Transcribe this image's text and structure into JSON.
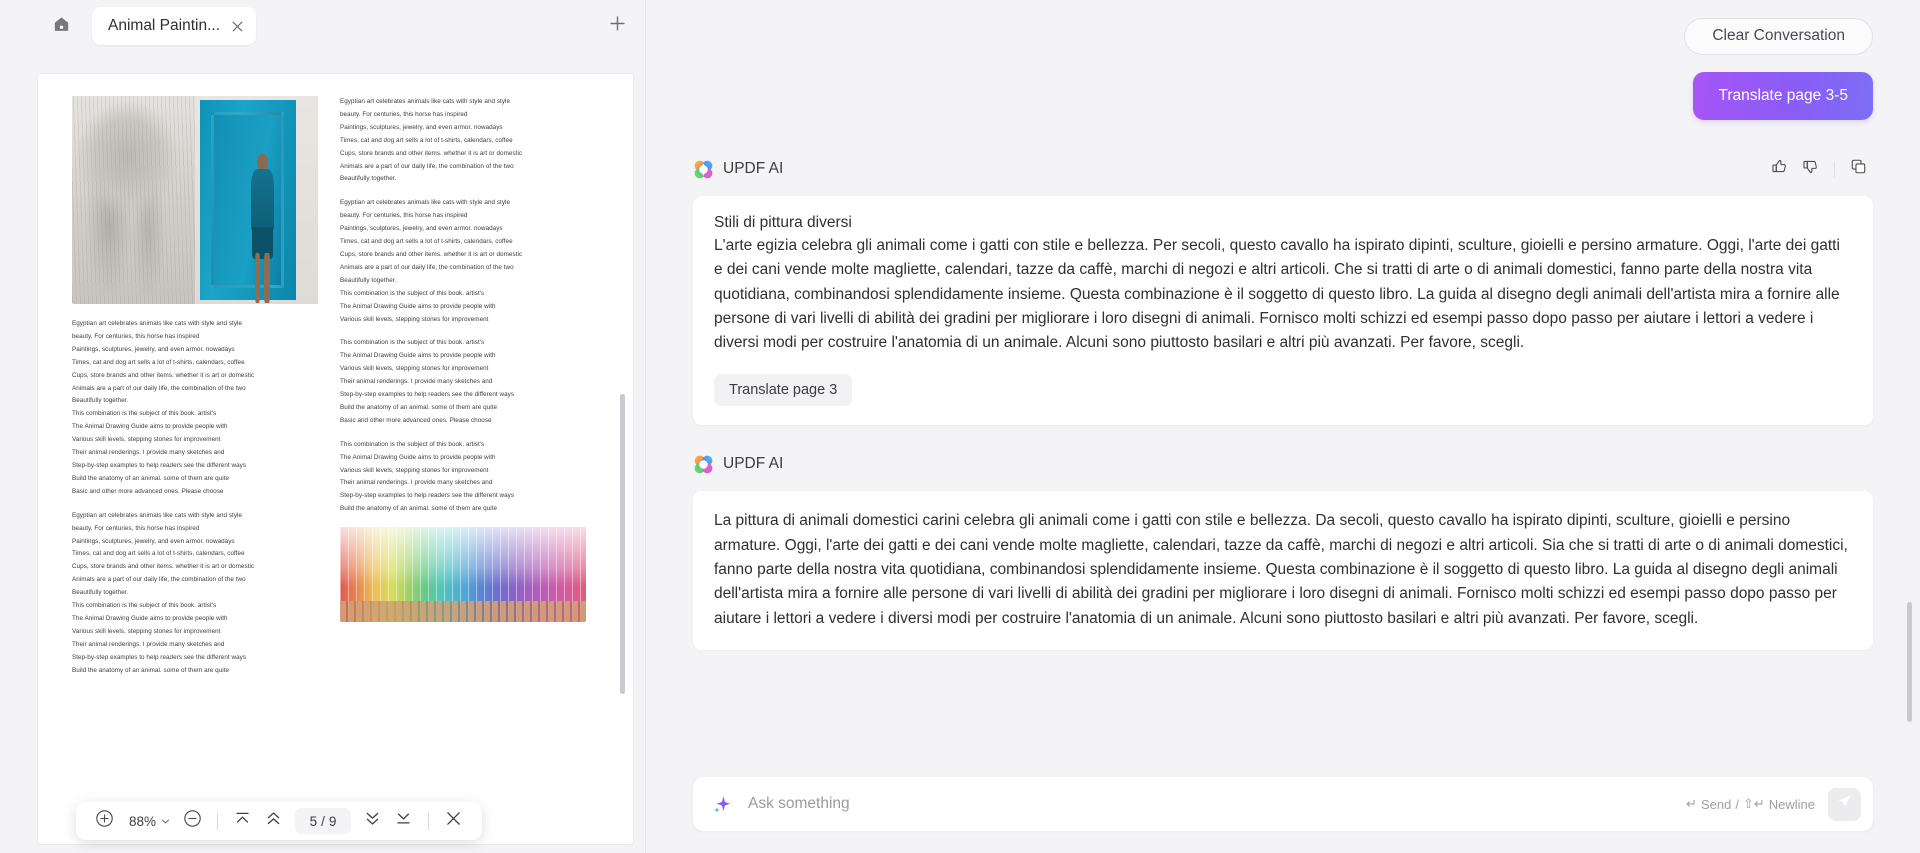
{
  "window": {
    "tab_title": "Animal Paintin...",
    "home_icon": "home-icon",
    "close_tab_icon": "close-icon",
    "new_tab_icon": "plus-icon"
  },
  "pdf": {
    "toolbar": {
      "zoom_in_icon": "plus-circle-icon",
      "zoom_level": "88%",
      "zoom_dropdown_icon": "chevron-down-icon",
      "zoom_out_icon": "minus-circle-icon",
      "first_page_icon": "jump-to-first-icon",
      "prev_page_icon": "chevron-up-double-icon",
      "page_current": "5",
      "page_separator": "/",
      "page_total": "9",
      "next_page_icon": "chevron-down-double-icon",
      "last_page_icon": "jump-to-last-icon",
      "close_icon": "close-icon"
    },
    "page_text": {
      "block1": [
        "Egyptian art celebrates animals like cats with style and style",
        "beauty. For centuries, this horse has inspired",
        "Paintings, sculptures, jewelry, and even armor. nowadays",
        "Times, cat and dog art sells a lot of t-shirts, calendars, coffee",
        "Cups, store brands and other items. whether it is art or domestic",
        "Animals are a part of our daily life, the combination of the two",
        "Beautifully together."
      ],
      "block2": [
        "Egyptian art celebrates animals like cats with style and style",
        "beauty. For centuries, this horse has inspired",
        "Paintings, sculptures, jewelry, and even armor. nowadays",
        "Times, cat and dog art sells a lot of t-shirts, calendars, coffee",
        "Cups, store brands and other items. whether it is art or domestic",
        "Animals are a part of our daily life, the combination of the two",
        "Beautifully together.",
        "This combination is the subject of this book. artist's",
        "The Animal Drawing Guide aims to provide people with",
        "Various skill levels, stepping stones for improvement",
        "Their animal renderings. I provide many sketches and",
        "Step-by-step examples to help readers see the different ways",
        "Build the anatomy of an animal. some of them are quite",
        "Basic and other more advanced ones. Please choose"
      ],
      "block3": [
        "Egyptian art celebrates animals like cats with style and style",
        "beauty. For centuries, this horse has inspired",
        "Paintings, sculptures, jewelry, and even armor. nowadays",
        "Times, cat and dog art sells a lot of t-shirts, calendars, coffee",
        "Cups, store brands and other items. whether it is art or domestic",
        "Animals are a part of our daily life, the combination of the two",
        "Beautifully together.",
        "This combination is the subject of this book. artist's",
        "The Animal Drawing Guide aims to provide people with",
        "Various skill levels, stepping stones for improvement",
        "Their animal renderings. I provide many sketches and",
        "Step-by-step examples to help readers see the different ways",
        "Build the anatomy of an animal. some of them are quite"
      ],
      "block4": [
        "This combination is the subject of this book. artist's",
        "The Animal Drawing Guide aims to provide people with",
        "Various skill levels, stepping stones for improvement",
        "Their animal renderings. I provide many sketches and",
        "Step-by-step examples to help readers see the different ways",
        "Build the anatomy of an animal. some of them are quite",
        "Basic and other more advanced ones. Please choose"
      ],
      "block5": [
        "Egyptian art celebrates animals like cats with style and style",
        "beauty. For centuries, this horse has inspired",
        "Paintings, sculptures, jewelry, and even armor. nowadays",
        "Times, cat and dog art sells a lot of t-shirts, calendars, coffee",
        "Cups, store brands and other items. whether it is art or domestic",
        "Animals are a part of our daily life, the combination of the two",
        "Beautifully together.",
        "This combination is the subject of this book. artist's",
        "The Animal Drawing Guide aims to provide people with",
        "Various skill levels, stepping stones for improvement"
      ],
      "block6": [
        "This combination is the subject of this book. artist's",
        "The Animal Drawing Guide aims to provide people with",
        "Various skill levels, stepping stones for improvement",
        "Their animal renderings. I provide many sketches and",
        "Step-by-step examples to help readers see the different ways",
        "Build the anatomy of an animal. some of them are quite"
      ]
    }
  },
  "chat": {
    "clear_label": "Clear Conversation",
    "user_message": "Translate page 3-5",
    "ai_label": "UPDF AI",
    "logo_icon": "updf-flower-icon",
    "thumbs_up_icon": "thumbs-up-icon",
    "thumbs_down_icon": "thumbs-down-icon",
    "copy_icon": "copy-icon",
    "response_1": {
      "title": "Stili di pittura diversi",
      "body": "L'arte egizia celebra gli animali come i gatti con stile e bellezza. Per secoli, questo cavallo ha ispirato dipinti, sculture, gioielli e persino armature. Oggi, l'arte dei gatti e dei cani vende molte magliette, calendari, tazze da caffè, marchi di negozi e altri articoli. Che si tratti di arte o di animali domestici, fanno parte della nostra vita quotidiana, combinandosi splendidamente insieme. Questa combinazione è il soggetto di questo libro. La guida al disegno degli animali dell'artista mira a fornire alle persone di vari livelli di abilità dei gradini per migliorare i loro disegni di animali. Fornisco molti schizzi ed esempi passo dopo passo per aiutare i lettori a vedere i diversi modi per costruire l'anatomia di un animale. Alcuni sono piuttosto basilari e altri più avanzati. Per favore, scegli.",
      "chip_label": "Translate page 3"
    },
    "response_2": {
      "body": "La pittura di animali domestici carini celebra gli animali come i gatti con stile e bellezza. Da secoli, questo cavallo ha ispirato dipinti, sculture, gioielli e persino armature. Oggi, l'arte dei gatti e dei cani vende molte magliette, calendari, tazze da caffè, marchi di negozi e altri articoli. Sia che si tratti di arte o di animali domestici, fanno parte della nostra vita quotidiana, combinandosi splendidamente insieme. Questa combinazione è il soggetto di questo libro. La guida al disegno degli animali dell'artista mira a fornire alle persone di vari livelli di abilità dei gradini per migliorare i loro disegni di animali. Fornisco molti schizzi ed esempi passo dopo passo per aiutare i lettori a vedere i diversi modi per costruire l'anatomia di un animale. Alcuni sono piuttosto basilari e altri più avanzati. Per favore, scegli."
    }
  },
  "composer": {
    "sparkle_icon": "sparkle-icon",
    "placeholder": "Ask something",
    "value": "",
    "hint_send": "Send",
    "hint_sep": "/",
    "hint_newline": "Newline",
    "send_icon": "send-paper-plane-icon"
  },
  "colors": {
    "user_bubble_start": "#a855f7",
    "user_bubble_end": "#7c6ff5",
    "app_bg": "#f4f4f6",
    "card_bg": "#ffffff",
    "text": "#2f3034"
  }
}
